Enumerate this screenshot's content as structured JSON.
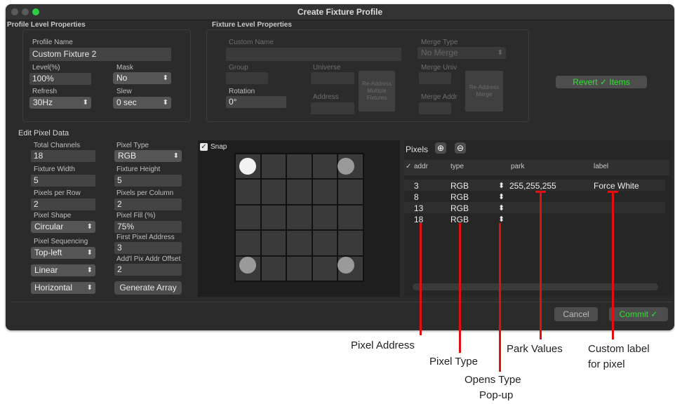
{
  "window": {
    "title": "Create Fixture Profile"
  },
  "profile": {
    "section": "Profile Level Properties",
    "name_label": "Profile Name",
    "name_value": "Custom Fixture 2",
    "level_label": "Level(%)",
    "level_value": "100%",
    "mask_label": "Mask",
    "mask_value": "No",
    "refresh_label": "Refresh",
    "refresh_value": "30Hz",
    "slew_label": "Slew",
    "slew_value": "0 sec"
  },
  "fixture": {
    "section": "Fixture Level Properties",
    "custom_name_label": "Custom Name",
    "merge_type_label": "Merge Type",
    "merge_type_value": "No Merge",
    "group_label": "Group",
    "universe_label": "Universe",
    "readdress_button": "Re-Address Multiple Fixtures",
    "merge_univ_label": "Merge Univ",
    "readdress_merge_button": "Re-Address Merge",
    "rotation_label": "Rotation",
    "rotation_value": "0°",
    "address_label": "Address",
    "merge_addr_label": "Merge Addr",
    "revert_button": "Revert ✓ Items"
  },
  "pixel_edit": {
    "section": "Edit Pixel Data",
    "total_channels_label": "Total Channels",
    "total_channels_value": "18",
    "pixel_type_label": "Pixel Type",
    "pixel_type_value": "RGB",
    "fixture_width_label": "Fixture Width",
    "fixture_width_value": "5",
    "fixture_height_label": "Fixture Height",
    "fixture_height_value": "5",
    "pixels_per_row_label": "Pixels per Row",
    "pixels_per_row_value": "2",
    "pixels_per_col_label": "Pixels per Column",
    "pixels_per_col_value": "2",
    "pixel_shape_label": "Pixel Shape",
    "pixel_shape_value": "Circular",
    "pixel_fill_label": "Pixel Fill (%)",
    "pixel_fill_value": "75%",
    "pixel_seq_label": "Pixel Sequencing",
    "pixel_seq_value": "Top-left",
    "first_addr_label": "First Pixel Address",
    "first_addr_value": "3",
    "offset_label": "Add'l Pix Addr Offset",
    "offset_value": "2",
    "linear_value": "Linear",
    "horizontal_value": "Horizontal",
    "generate_button": "Generate Array",
    "snap_label": "Snap"
  },
  "pixels": {
    "title": "Pixels",
    "columns": {
      "check": "✓",
      "addr": "addr",
      "type": "type",
      "park": "park",
      "label": "label"
    },
    "rows": [
      {
        "addr": "3",
        "type": "RGB",
        "park": "255,255,255",
        "label": "Force White"
      },
      {
        "addr": "8",
        "type": "RGB",
        "park": "",
        "label": ""
      },
      {
        "addr": "13",
        "type": "RGB",
        "park": "",
        "label": ""
      },
      {
        "addr": "18",
        "type": "RGB",
        "park": "",
        "label": ""
      }
    ]
  },
  "footer": {
    "cancel": "Cancel",
    "commit": "Commit ✓"
  },
  "annotations": {
    "pixel_address": "Pixel Address",
    "pixel_type": "Pixel Type",
    "park_values": "Park Values",
    "custom_label_1": "Custom label",
    "custom_label_2": "for pixel",
    "opens_type_1": "Opens Type",
    "opens_type_2": "Pop-up"
  },
  "colors": {
    "accent_green": "#2ee32e",
    "annotation_red": "#e01010",
    "window_bg": "#2b2b2b"
  }
}
